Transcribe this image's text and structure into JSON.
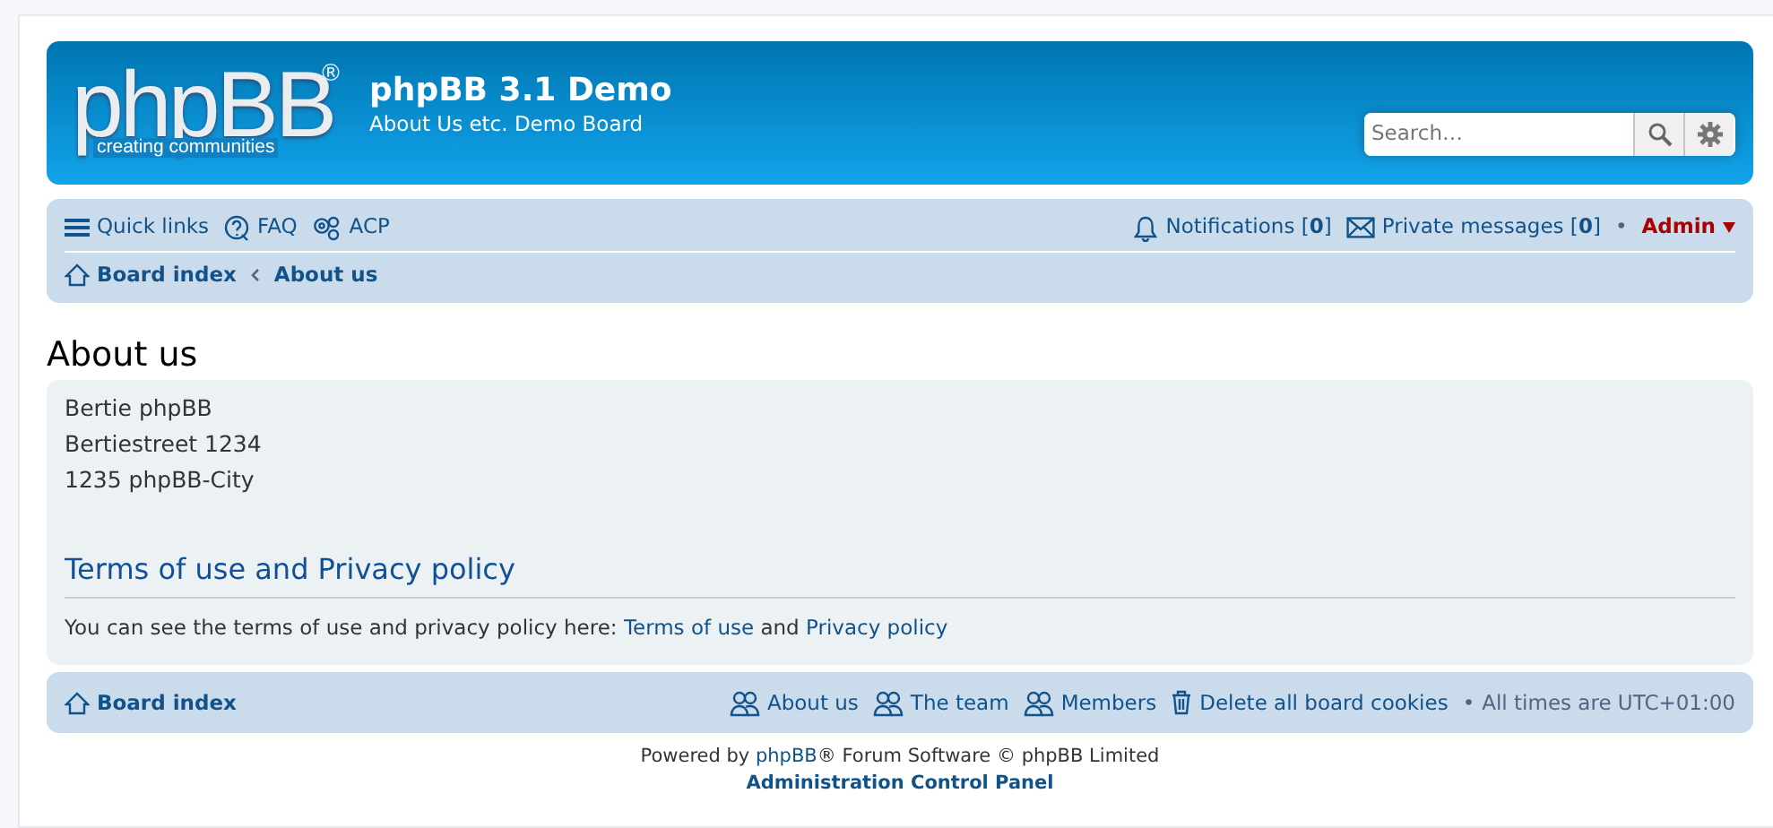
{
  "logo": {
    "wordmark": "phpBB",
    "mark": "®",
    "tagline": "creating communities"
  },
  "site": {
    "title": "phpBB 3.1 Demo",
    "description": "About Us etc. Demo Board"
  },
  "search": {
    "placeholder": "Search…"
  },
  "quick_links": [
    {
      "kind": "menu",
      "label": "Quick links"
    },
    {
      "kind": "faq",
      "label": "FAQ"
    },
    {
      "kind": "acp",
      "label": "ACP"
    }
  ],
  "user_links": [
    {
      "kind": "bell",
      "label": "Notifications",
      "open": "[",
      "count": "0",
      "close": "]"
    },
    {
      "kind": "mail",
      "label": "Private messages",
      "open": "[",
      "count": "0",
      "close": "]"
    }
  ],
  "user": {
    "separator": "•",
    "name": "Admin"
  },
  "breadcrumbs": [
    "Board index",
    "About us"
  ],
  "page_title": "About us",
  "address_lines": [
    "Bertie phpBB",
    "Bertiestreet 1234",
    "1235 phpBB-City"
  ],
  "section_title": "Terms of use and Privacy policy",
  "terms": {
    "prefix": "You can see the terms of use and privacy policy here: ",
    "link_1": "Terms of use",
    "joiner": " and ",
    "link_2": "Privacy policy"
  },
  "footer": {
    "home": "Board index",
    "links": [
      {
        "kind": "team",
        "label": "About us"
      },
      {
        "kind": "team",
        "label": "The team"
      },
      {
        "kind": "team",
        "label": "Members"
      },
      {
        "kind": "trash",
        "label": "Delete all board cookies"
      }
    ],
    "separator": "•",
    "timezone": "All times are UTC+01:00"
  },
  "copyright": {
    "prefix": "Powered by ",
    "link": "phpBB",
    "suffix": "® Forum Software © phpBB Limited",
    "acp": "Administration Control Panel"
  }
}
